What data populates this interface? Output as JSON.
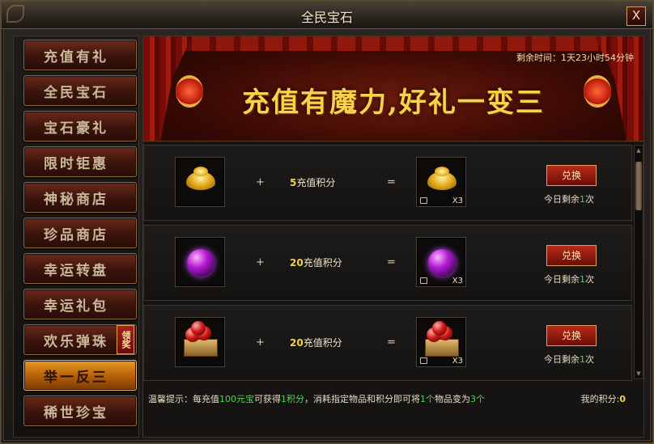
{
  "window": {
    "title": "全民宝石",
    "close_label": "X"
  },
  "sidebar": {
    "items": [
      {
        "label": "充值有礼"
      },
      {
        "label": "全民宝石"
      },
      {
        "label": "宝石豪礼"
      },
      {
        "label": "限时钜惠"
      },
      {
        "label": "神秘商店"
      },
      {
        "label": "珍品商店"
      },
      {
        "label": "幸运转盘"
      },
      {
        "label": "幸运礼包"
      },
      {
        "label": "欢乐弹珠",
        "badge": "领奖"
      },
      {
        "label": "举一反三",
        "active": true
      },
      {
        "label": "稀世珍宝"
      }
    ]
  },
  "banner": {
    "timer": "剩余时间：1天23小时54分钟",
    "slogan": "充值有魔力,好礼一变三"
  },
  "exchange": {
    "plus": "+",
    "equals": "=",
    "redeem_label": "兑换",
    "rows": [
      {
        "input_item": "gold-ingot",
        "points_num": "5",
        "points_text": "充值积分",
        "output_qty": "X3",
        "remain_prefix": "今日剩余",
        "remain_n": "1",
        "remain_suffix": "次"
      },
      {
        "input_item": "purple-orb",
        "points_num": "20",
        "points_text": "充值积分",
        "output_qty": "X3",
        "remain_prefix": "今日剩余",
        "remain_n": "1",
        "remain_suffix": "次"
      },
      {
        "input_item": "red-gem-box",
        "points_num": "20",
        "points_text": "充值积分",
        "output_qty": "X3",
        "remain_prefix": "今日剩余",
        "remain_n": "1",
        "remain_suffix": "次"
      }
    ]
  },
  "footer": {
    "tip_1": "温馨提示：每充值",
    "tip_g1": "100元宝",
    "tip_2": "可获得",
    "tip_g2": "1积分",
    "tip_3": "，消耗指定物品和积分即可将",
    "tip_g3": "1个",
    "tip_4": "物品变为",
    "tip_g4": "3个",
    "my_points_label": "我的积分:",
    "my_points_value": "0"
  },
  "colors": {
    "accent_gold": "#f5d24a",
    "green": "#4ad84a",
    "active_tab": "#e89a22"
  }
}
